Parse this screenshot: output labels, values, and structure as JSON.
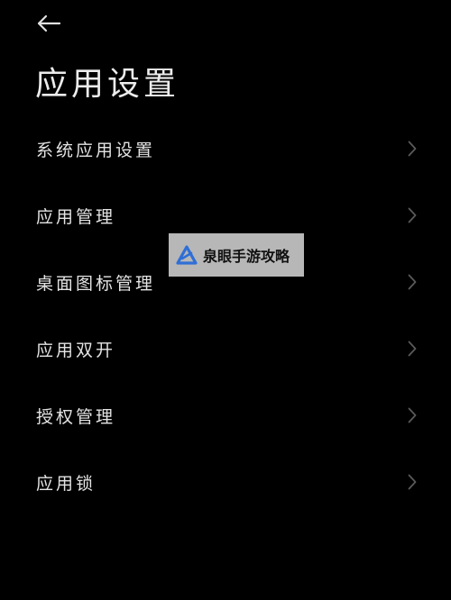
{
  "header": {
    "back_icon": "arrow-left-icon",
    "title": "应用设置"
  },
  "menu": {
    "items": [
      {
        "label": "系统应用设置",
        "icon": "chevron-right-icon"
      },
      {
        "label": "应用管理",
        "icon": "chevron-right-icon"
      },
      {
        "label": "桌面图标管理",
        "icon": "chevron-right-icon"
      },
      {
        "label": "应用双开",
        "icon": "chevron-right-icon"
      },
      {
        "label": "授权管理",
        "icon": "chevron-right-icon"
      },
      {
        "label": "应用锁",
        "icon": "chevron-right-icon"
      }
    ]
  },
  "watermark": {
    "text": "泉眼手游攻略",
    "logo_icon": "triangle-logo-icon",
    "background": "#b7b7b7",
    "logo_color": "#2f6fd6"
  },
  "colors": {
    "background": "#000000",
    "text": "#e4e4e4",
    "chevron": "#5a5a5a"
  }
}
